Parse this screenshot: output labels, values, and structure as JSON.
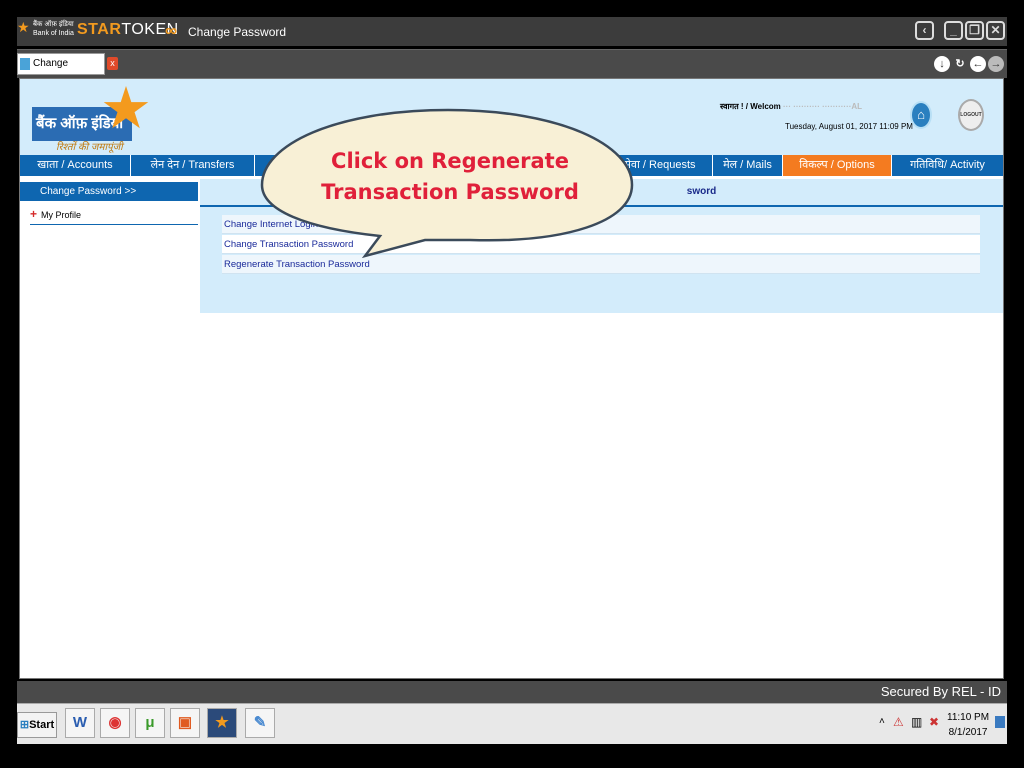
{
  "window": {
    "title": "Change Password",
    "brand_hindi": "बैंक ऑफ़ इंडिया",
    "brand_english": "Bank of India",
    "product_name_star": "STAR",
    "product_name_token": "TOKEN"
  },
  "tab": {
    "label": "Change Passw..."
  },
  "header": {
    "logo_text": "बैंक ऑफ़ इंडिया",
    "tagline": "रिश्तों की जमापूंजी",
    "welcome": "स्वागत ! / Welcom",
    "welcome_hidden": "··· ·········· ···········AL",
    "datetime": "Tuesday, August 01, 2017 11:09 PM",
    "logout_label": "LOGOUT"
  },
  "menu": [
    {
      "label": "खाता / Accounts"
    },
    {
      "label": "लेन देन / Transfers"
    },
    {
      "label": ""
    },
    {
      "label": ""
    },
    {
      "label": "सेवा / Requests"
    },
    {
      "label": "मेल / Mails"
    },
    {
      "label": "विकल्प / Options"
    },
    {
      "label": "गतिविधि/ Activity"
    }
  ],
  "sidebar": {
    "heading": "Change Password >>",
    "items": [
      {
        "label": "My Profile"
      }
    ]
  },
  "main": {
    "panel_title": "sword",
    "options": [
      {
        "label": "Change Internet Login Pass"
      },
      {
        "label": "Change Transaction Password"
      },
      {
        "label": "Regenerate Transaction Password"
      }
    ]
  },
  "callout": {
    "line1": "Click on Regenerate",
    "line2": "Transaction Password"
  },
  "statusbar": {
    "secured_by": "Secured By REL - ID"
  },
  "taskbar": {
    "start_label": "Start",
    "apps": [
      "word-icon",
      "chrome-icon",
      "utorrent-icon",
      "office-icon",
      "startoken-icon",
      "paint-icon"
    ],
    "clock_time": "11:10 PM",
    "clock_date": "8/1/2017"
  },
  "colors": {
    "menu_blue": "#0e66b0",
    "menu_active": "#f47b20",
    "header_bg": "#d3ecfb",
    "callout_text": "#e0203a",
    "callout_fill": "#f8f0d6"
  }
}
